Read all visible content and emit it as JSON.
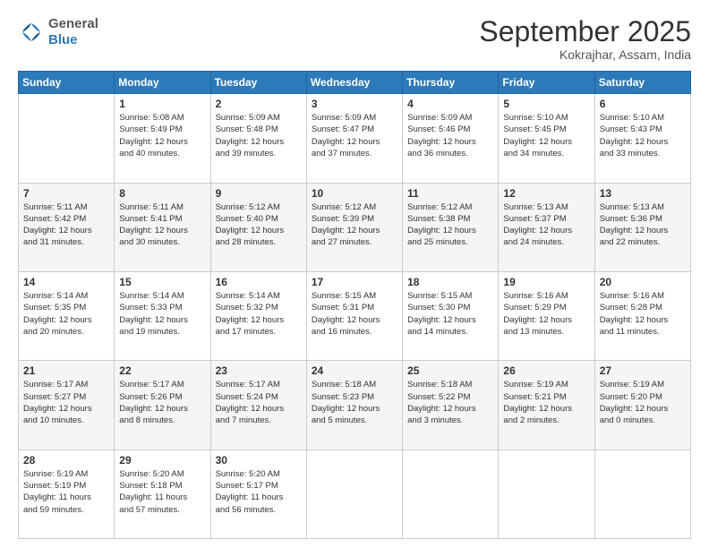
{
  "header": {
    "logo_general": "General",
    "logo_blue": "Blue",
    "month_title": "September 2025",
    "location": "Kokrajhar, Assam, India"
  },
  "days_of_week": [
    "Sunday",
    "Monday",
    "Tuesday",
    "Wednesday",
    "Thursday",
    "Friday",
    "Saturday"
  ],
  "weeks": [
    [
      {
        "num": "",
        "info": ""
      },
      {
        "num": "1",
        "info": "Sunrise: 5:08 AM\nSunset: 5:49 PM\nDaylight: 12 hours\nand 40 minutes."
      },
      {
        "num": "2",
        "info": "Sunrise: 5:09 AM\nSunset: 5:48 PM\nDaylight: 12 hours\nand 39 minutes."
      },
      {
        "num": "3",
        "info": "Sunrise: 5:09 AM\nSunset: 5:47 PM\nDaylight: 12 hours\nand 37 minutes."
      },
      {
        "num": "4",
        "info": "Sunrise: 5:09 AM\nSunset: 5:46 PM\nDaylight: 12 hours\nand 36 minutes."
      },
      {
        "num": "5",
        "info": "Sunrise: 5:10 AM\nSunset: 5:45 PM\nDaylight: 12 hours\nand 34 minutes."
      },
      {
        "num": "6",
        "info": "Sunrise: 5:10 AM\nSunset: 5:43 PM\nDaylight: 12 hours\nand 33 minutes."
      }
    ],
    [
      {
        "num": "7",
        "info": "Sunrise: 5:11 AM\nSunset: 5:42 PM\nDaylight: 12 hours\nand 31 minutes."
      },
      {
        "num": "8",
        "info": "Sunrise: 5:11 AM\nSunset: 5:41 PM\nDaylight: 12 hours\nand 30 minutes."
      },
      {
        "num": "9",
        "info": "Sunrise: 5:12 AM\nSunset: 5:40 PM\nDaylight: 12 hours\nand 28 minutes."
      },
      {
        "num": "10",
        "info": "Sunrise: 5:12 AM\nSunset: 5:39 PM\nDaylight: 12 hours\nand 27 minutes."
      },
      {
        "num": "11",
        "info": "Sunrise: 5:12 AM\nSunset: 5:38 PM\nDaylight: 12 hours\nand 25 minutes."
      },
      {
        "num": "12",
        "info": "Sunrise: 5:13 AM\nSunset: 5:37 PM\nDaylight: 12 hours\nand 24 minutes."
      },
      {
        "num": "13",
        "info": "Sunrise: 5:13 AM\nSunset: 5:36 PM\nDaylight: 12 hours\nand 22 minutes."
      }
    ],
    [
      {
        "num": "14",
        "info": "Sunrise: 5:14 AM\nSunset: 5:35 PM\nDaylight: 12 hours\nand 20 minutes."
      },
      {
        "num": "15",
        "info": "Sunrise: 5:14 AM\nSunset: 5:33 PM\nDaylight: 12 hours\nand 19 minutes."
      },
      {
        "num": "16",
        "info": "Sunrise: 5:14 AM\nSunset: 5:32 PM\nDaylight: 12 hours\nand 17 minutes."
      },
      {
        "num": "17",
        "info": "Sunrise: 5:15 AM\nSunset: 5:31 PM\nDaylight: 12 hours\nand 16 minutes."
      },
      {
        "num": "18",
        "info": "Sunrise: 5:15 AM\nSunset: 5:30 PM\nDaylight: 12 hours\nand 14 minutes."
      },
      {
        "num": "19",
        "info": "Sunrise: 5:16 AM\nSunset: 5:29 PM\nDaylight: 12 hours\nand 13 minutes."
      },
      {
        "num": "20",
        "info": "Sunrise: 5:16 AM\nSunset: 5:28 PM\nDaylight: 12 hours\nand 11 minutes."
      }
    ],
    [
      {
        "num": "21",
        "info": "Sunrise: 5:17 AM\nSunset: 5:27 PM\nDaylight: 12 hours\nand 10 minutes."
      },
      {
        "num": "22",
        "info": "Sunrise: 5:17 AM\nSunset: 5:26 PM\nDaylight: 12 hours\nand 8 minutes."
      },
      {
        "num": "23",
        "info": "Sunrise: 5:17 AM\nSunset: 5:24 PM\nDaylight: 12 hours\nand 7 minutes."
      },
      {
        "num": "24",
        "info": "Sunrise: 5:18 AM\nSunset: 5:23 PM\nDaylight: 12 hours\nand 5 minutes."
      },
      {
        "num": "25",
        "info": "Sunrise: 5:18 AM\nSunset: 5:22 PM\nDaylight: 12 hours\nand 3 minutes."
      },
      {
        "num": "26",
        "info": "Sunrise: 5:19 AM\nSunset: 5:21 PM\nDaylight: 12 hours\nand 2 minutes."
      },
      {
        "num": "27",
        "info": "Sunrise: 5:19 AM\nSunset: 5:20 PM\nDaylight: 12 hours\nand 0 minutes."
      }
    ],
    [
      {
        "num": "28",
        "info": "Sunrise: 5:19 AM\nSunset: 5:19 PM\nDaylight: 11 hours\nand 59 minutes."
      },
      {
        "num": "29",
        "info": "Sunrise: 5:20 AM\nSunset: 5:18 PM\nDaylight: 11 hours\nand 57 minutes."
      },
      {
        "num": "30",
        "info": "Sunrise: 5:20 AM\nSunset: 5:17 PM\nDaylight: 11 hours\nand 56 minutes."
      },
      {
        "num": "",
        "info": ""
      },
      {
        "num": "",
        "info": ""
      },
      {
        "num": "",
        "info": ""
      },
      {
        "num": "",
        "info": ""
      }
    ]
  ]
}
